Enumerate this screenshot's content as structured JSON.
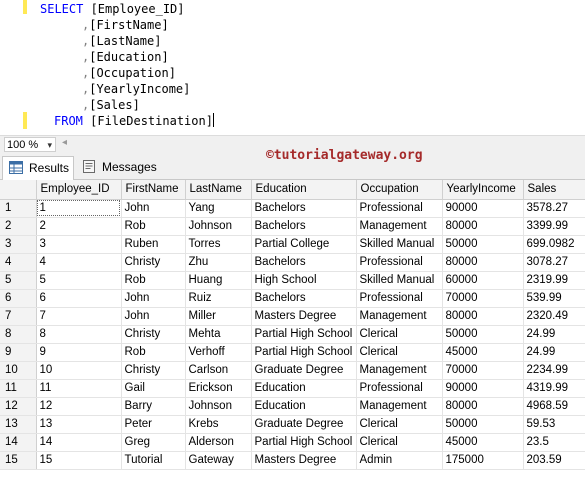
{
  "editor": {
    "lines": [
      {
        "kw": "SELECT",
        "punc": "",
        "text": " [Employee_ID]"
      },
      {
        "kw": "",
        "punc": ",",
        "text": "[FirstName]"
      },
      {
        "kw": "",
        "punc": ",",
        "text": "[LastName]"
      },
      {
        "kw": "",
        "punc": ",",
        "text": "[Education]"
      },
      {
        "kw": "",
        "punc": ",",
        "text": "[Occupation]"
      },
      {
        "kw": "",
        "punc": ",",
        "text": "[YearlyIncome]"
      },
      {
        "kw": "",
        "punc": ",",
        "text": "[Sales]"
      },
      {
        "kw": "FROM",
        "punc": "",
        "text": " [FileDestination]"
      }
    ]
  },
  "zoom": {
    "value": "100 %",
    "arrow": "▾",
    "scroll_left": "◂"
  },
  "tabs": {
    "results_label": "Results",
    "messages_label": "Messages"
  },
  "watermark": "©tutorialgateway.org",
  "grid": {
    "headers": [
      "",
      "Employee_ID",
      "FirstName",
      "LastName",
      "Education",
      "Occupation",
      "YearlyIncome",
      "Sales"
    ],
    "rows": [
      [
        "1",
        "1",
        "John",
        "Yang",
        "Bachelors",
        "Professional",
        "90000",
        "3578.27"
      ],
      [
        "2",
        "2",
        "Rob",
        "Johnson",
        "Bachelors",
        "Management",
        "80000",
        "3399.99"
      ],
      [
        "3",
        "3",
        "Ruben",
        "Torres",
        "Partial College",
        "Skilled Manual",
        "50000",
        "699.0982"
      ],
      [
        "4",
        "4",
        "Christy",
        "Zhu",
        "Bachelors",
        "Professional",
        "80000",
        "3078.27"
      ],
      [
        "5",
        "5",
        "Rob",
        "Huang",
        "High School",
        "Skilled Manual",
        "60000",
        "2319.99"
      ],
      [
        "6",
        "6",
        "John",
        "Ruiz",
        "Bachelors",
        "Professional",
        "70000",
        "539.99"
      ],
      [
        "7",
        "7",
        "John",
        "Miller",
        "Masters Degree",
        "Management",
        "80000",
        "2320.49"
      ],
      [
        "8",
        "8",
        "Christy",
        "Mehta",
        "Partial High School",
        "Clerical",
        "50000",
        "24.99"
      ],
      [
        "9",
        "9",
        "Rob",
        "Verhoff",
        "Partial High School",
        "Clerical",
        "45000",
        "24.99"
      ],
      [
        "10",
        "10",
        "Christy",
        "Carlson",
        "Graduate Degree",
        "Management",
        "70000",
        "2234.99"
      ],
      [
        "11",
        "11",
        "Gail",
        "Erickson",
        "Education",
        "Professional",
        "90000",
        "4319.99"
      ],
      [
        "12",
        "12",
        "Barry",
        "Johnson",
        "Education",
        "Management",
        "80000",
        "4968.59"
      ],
      [
        "13",
        "13",
        "Peter",
        "Krebs",
        "Graduate Degree",
        "Clerical",
        "50000",
        "59.53"
      ],
      [
        "14",
        "14",
        "Greg",
        "Alderson",
        "Partial High School",
        "Clerical",
        "45000",
        "23.5"
      ],
      [
        "15",
        "15",
        "Tutorial",
        "Gateway",
        "Masters Degree",
        "Admin",
        "175000",
        "203.59"
      ]
    ]
  }
}
